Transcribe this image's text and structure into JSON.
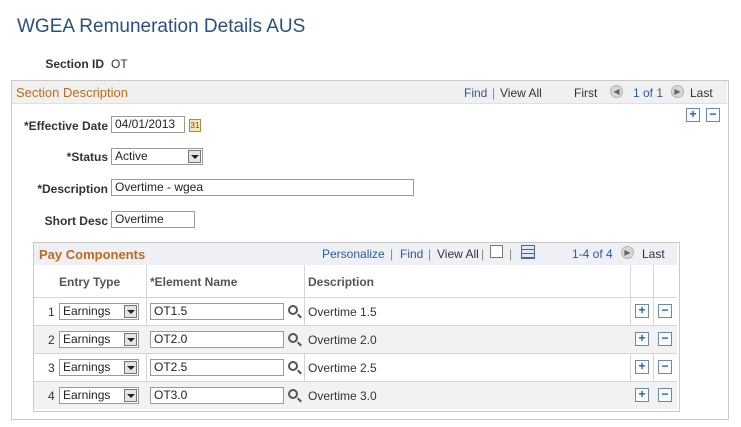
{
  "page_title": "WGEA Remuneration Details AUS",
  "section_id": {
    "label": "Section ID",
    "value": "OT"
  },
  "section_description": {
    "title": "Section Description",
    "find": "Find",
    "view_all": "View All",
    "first": "First",
    "count": "1 of 1",
    "last": "Last"
  },
  "form": {
    "effective_date": {
      "label": "*Effective Date",
      "value": "04/01/2013"
    },
    "status": {
      "label": "*Status",
      "value": "Active"
    },
    "description": {
      "label": "*Description",
      "value": "Overtime - wgea"
    },
    "short_desc": {
      "label": "Short Desc",
      "value": "Overtime"
    }
  },
  "pay_components": {
    "title": "Pay Components",
    "personalize": "Personalize",
    "find": "Find",
    "view_all": "View All",
    "count": "1-4 of 4",
    "last": "Last",
    "columns": [
      "Entry Type",
      "*Element Name",
      "Description"
    ],
    "rows": [
      {
        "num": "1",
        "entry_type": "Earnings",
        "element_name": "OT1.5",
        "description": "Overtime 1.5"
      },
      {
        "num": "2",
        "entry_type": "Earnings",
        "element_name": "OT2.0",
        "description": "Overtime 2.0"
      },
      {
        "num": "3",
        "entry_type": "Earnings",
        "element_name": "OT2.5",
        "description": "Overtime 2.5"
      },
      {
        "num": "4",
        "entry_type": "Earnings",
        "element_name": "OT3.0",
        "description": "Overtime 3.0"
      }
    ]
  },
  "glyphs": {
    "plus": "+",
    "minus": "−",
    "sep": "|",
    "prev": "◀",
    "next": "▶",
    "calendar": "31"
  }
}
